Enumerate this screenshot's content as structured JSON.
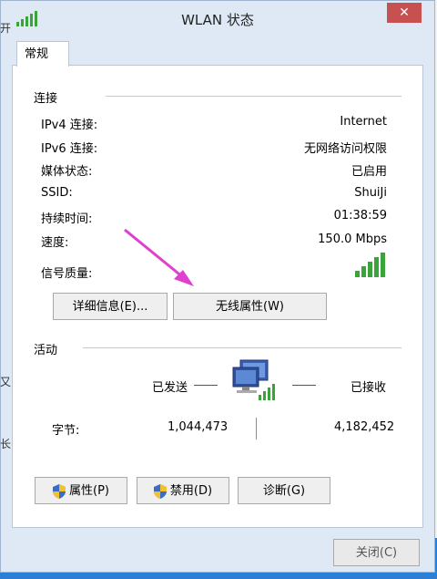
{
  "window": {
    "title": "WLAN 状态",
    "close_symbol": "✕"
  },
  "tab": {
    "label": "常规"
  },
  "connection": {
    "header": "连接",
    "rows": [
      {
        "label": "IPv4 连接:",
        "value": "Internet"
      },
      {
        "label": "IPv6 连接:",
        "value": "无网络访问权限"
      },
      {
        "label": "媒体状态:",
        "value": "已启用"
      },
      {
        "label": "SSID:",
        "value": "ShuiJi"
      },
      {
        "label": "持续时间:",
        "value": "01:38:59"
      },
      {
        "label": "速度:",
        "value": "150.0 Mbps"
      },
      {
        "label": "信号质量:",
        "value": ""
      }
    ],
    "details_button": "详细信息(E)...",
    "wireless_props_button": "无线属性(W)"
  },
  "activity": {
    "header": "活动",
    "sent_label": "已发送",
    "received_label": "已接收",
    "bytes_label": "字节:",
    "bytes_sent": "1,044,473",
    "bytes_received": "4,182,452"
  },
  "buttons": {
    "properties": "属性(P)",
    "disable": "禁用(D)",
    "diagnose": "诊断(G)",
    "close": "关闭(C)"
  },
  "background": {
    "frag_top": "开",
    "frag_mid1": "又",
    "frag_mid2": "长"
  },
  "colors": {
    "signal_green": "#3aa43a",
    "arrow_magenta": "#e040d0",
    "close_red": "#c75050"
  }
}
